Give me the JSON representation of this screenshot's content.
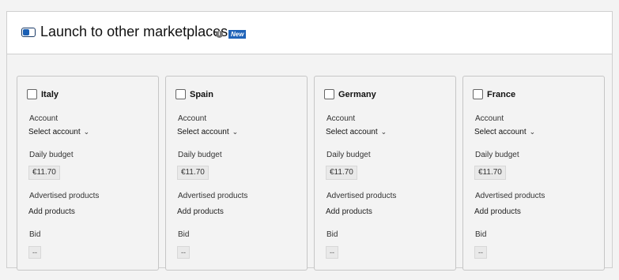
{
  "header": {
    "title": "Launch to other marketplaces",
    "badge": "New",
    "info_icon": "i"
  },
  "labels": {
    "account": "Account",
    "select_account": "Select account",
    "daily_budget": "Daily budget",
    "advertised_products": "Advertised products",
    "add_products": "Add products",
    "bid": "Bid"
  },
  "marketplaces": [
    {
      "name": "Italy",
      "budget": "€11.70",
      "bid": "--",
      "checked": false
    },
    {
      "name": "Spain",
      "budget": "€11.70",
      "bid": "--",
      "checked": false
    },
    {
      "name": "Germany",
      "budget": "€11.70",
      "bid": "--",
      "checked": false
    },
    {
      "name": "France",
      "budget": "€11.70",
      "bid": "--",
      "checked": false
    }
  ],
  "icons": {
    "toggle": "toggle-icon",
    "chevron": "chevron-down-icon",
    "info": "info-icon"
  },
  "colors": {
    "accent": "#1f63b8",
    "background": "#f3f3f3"
  }
}
